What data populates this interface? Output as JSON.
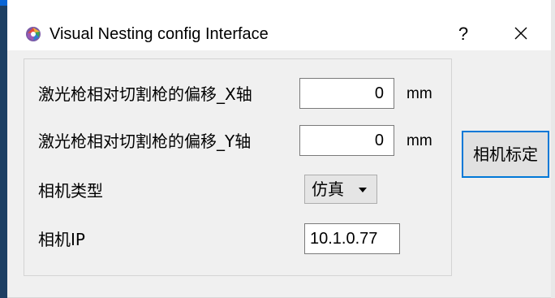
{
  "window": {
    "title": "Visual Nesting config Interface",
    "help_label": "?",
    "icon": "visual-nesting-app-icon",
    "close_icon": "close-icon"
  },
  "form": {
    "offset_x": {
      "label": "激光枪相对切割枪的偏移_X轴",
      "value": "0",
      "unit": "mm"
    },
    "offset_y": {
      "label": "激光枪相对切割枪的偏移_Y轴",
      "value": "0",
      "unit": "mm"
    },
    "camera_type": {
      "label": "相机类型",
      "selected": "仿真"
    },
    "camera_ip": {
      "label": "相机IP",
      "value": "10.1.0.77"
    }
  },
  "actions": {
    "calibrate_label": "相机标定"
  },
  "colors": {
    "accent": "#0078d7",
    "client_bg": "#f0f0f0",
    "taskbar_edge": "#1d3f63"
  }
}
